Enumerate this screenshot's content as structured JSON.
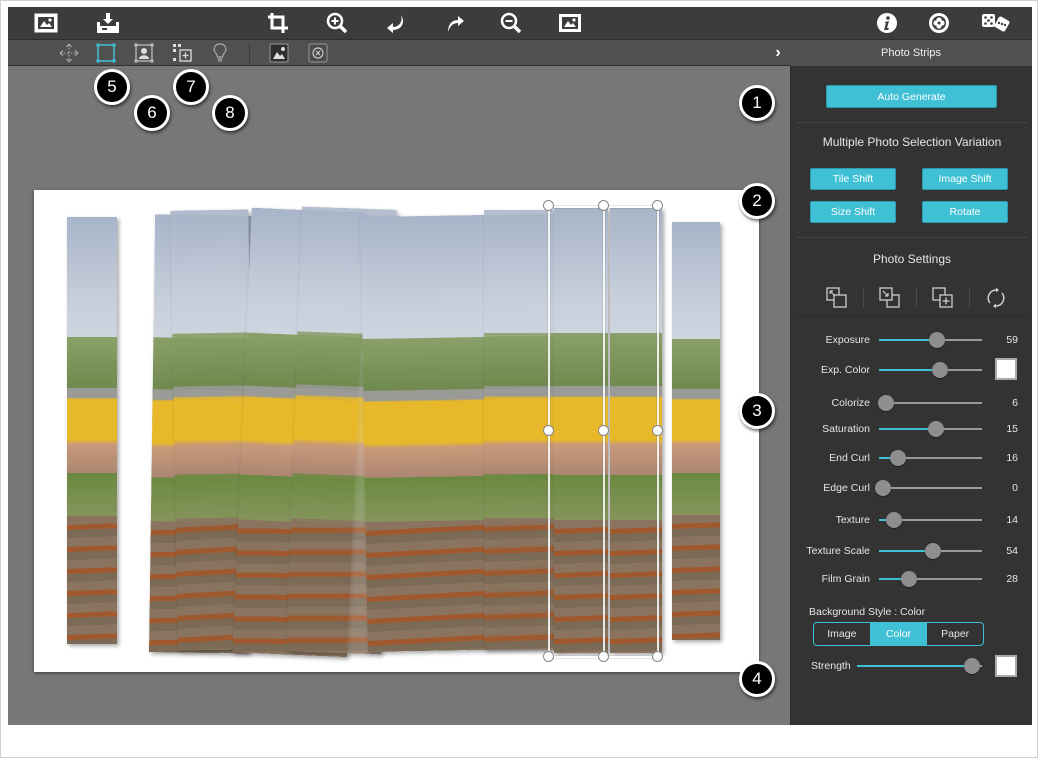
{
  "toolbar": {
    "icons": [
      {
        "name": "open-photo-icon"
      },
      {
        "name": "save-export-icon"
      },
      {
        "name": "crop-icon"
      },
      {
        "name": "zoom-in-icon"
      },
      {
        "name": "undo-icon"
      },
      {
        "name": "redo-icon"
      },
      {
        "name": "zoom-out-icon"
      },
      {
        "name": "fit-image-icon"
      },
      {
        "name": "info-icon"
      },
      {
        "name": "settings-icon"
      },
      {
        "name": "randomize-dice-icon"
      }
    ]
  },
  "subtoolbar": {
    "tools": [
      {
        "name": "move-tool-icon",
        "active": false
      },
      {
        "name": "select-tool-icon",
        "active": true
      },
      {
        "name": "portrait-frame-icon",
        "active": false
      },
      {
        "name": "add-strip-icon",
        "active": false
      },
      {
        "name": "lightbulb-icon",
        "active": false
      },
      {
        "name": "replace-image-icon",
        "active": false
      },
      {
        "name": "delete-icon",
        "active": false
      }
    ],
    "collapse_chevron": "›"
  },
  "panel": {
    "title": "Photo Strips",
    "auto_generate": "Auto Generate",
    "variation_title": "Multiple Photo Selection Variation",
    "variation_buttons": [
      "Tile Shift",
      "Image Shift",
      "Size Shift",
      "Rotate"
    ],
    "photo_settings_title": "Photo Settings",
    "photo_settings_icons": [
      "send-backward-icon",
      "bring-forward-icon",
      "duplicate-icon",
      "rotate-refresh-icon"
    ],
    "sliders": [
      {
        "label": "Exposure",
        "value": "59",
        "fraction": 0.56
      },
      {
        "label": "Exp. Color",
        "value": "",
        "fraction": 0.59,
        "swatch": "#ffffff"
      },
      {
        "label": "Colorize",
        "value": "6",
        "fraction": 0.07
      },
      {
        "label": "Saturation",
        "value": "15",
        "fraction": 0.55
      },
      {
        "label": "End Curl",
        "value": "16",
        "fraction": 0.18
      },
      {
        "label": "Edge Curl",
        "value": "0",
        "fraction": 0.04
      },
      {
        "label": "Texture",
        "value": "14",
        "fraction": 0.15
      },
      {
        "label": "Texture Scale",
        "value": "54",
        "fraction": 0.52
      },
      {
        "label": "Film Grain",
        "value": "28",
        "fraction": 0.29
      }
    ],
    "background_style_label": "Background Style : Color",
    "background_options": [
      "Image",
      "Color",
      "Paper"
    ],
    "background_selected": "Color",
    "strength": {
      "label": "Strength",
      "fraction": 0.92,
      "swatch": "#ffffff"
    }
  },
  "callouts": [
    "1",
    "2",
    "3",
    "4",
    "5",
    "6",
    "7",
    "8"
  ],
  "colors": {
    "accent": "#3fc0d4",
    "toolbar_bg": "#3c3c3c",
    "panel_bg": "#333333",
    "canvas_bg": "#777777"
  }
}
